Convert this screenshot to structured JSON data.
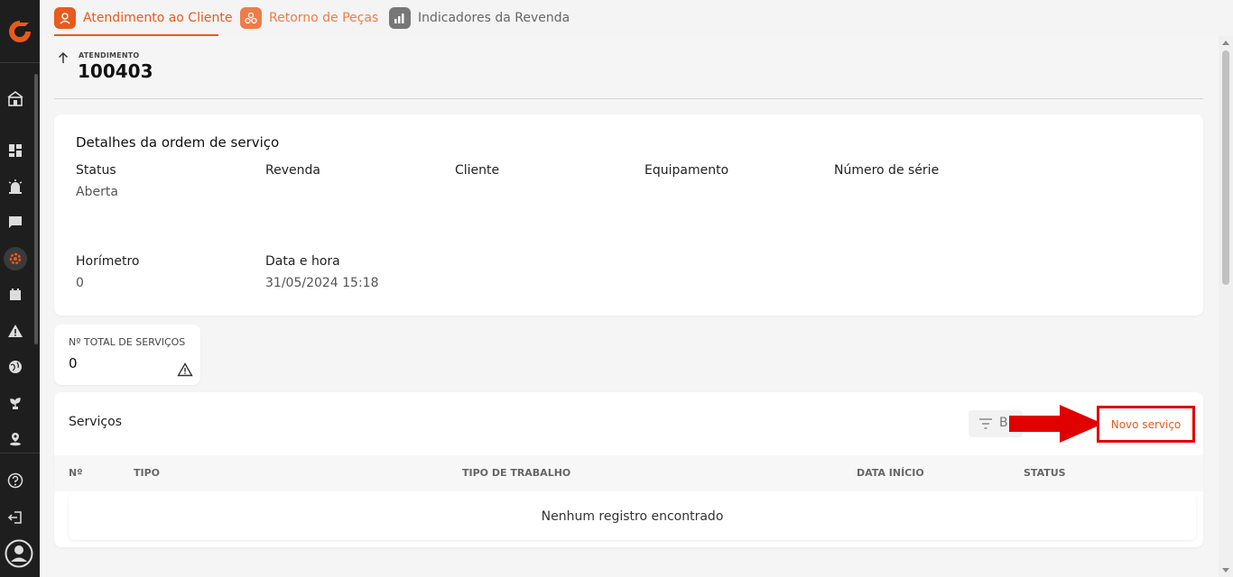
{
  "tabs": [
    {
      "label": "Atendimento ao Cliente",
      "color": "#e85a1d"
    },
    {
      "label": "Retorno de Peças",
      "color": "#ef7b48"
    },
    {
      "label": "Indicadores da Revenda",
      "color": "#777777"
    }
  ],
  "header": {
    "sup_label": "ATENDIMENTO",
    "number": "100403"
  },
  "details": {
    "title": "Detalhes da ordem de serviço",
    "fields": [
      {
        "label": "Status",
        "value": "Aberta"
      },
      {
        "label": "Revenda",
        "value": ""
      },
      {
        "label": "Cliente",
        "value": ""
      },
      {
        "label": "Equipamento",
        "value": ""
      },
      {
        "label": "Número de série",
        "value": ""
      },
      {
        "label": "Horímetro",
        "value": "0"
      },
      {
        "label": "Data e hora",
        "value": "31/05/2024 15:18"
      }
    ]
  },
  "total": {
    "label": "Nº TOTAL DE SERVIÇOS",
    "value": "0"
  },
  "services": {
    "title": "Serviços",
    "filter_label": "B",
    "new_button": "Novo serviço",
    "columns": [
      "Nº",
      "TIPO",
      "TIPO DE TRABALHO",
      "DATA INÍCIO",
      "STATUS"
    ],
    "empty_text": "Nenhum registro encontrado"
  },
  "colors": {
    "accent": "#e85a1d",
    "highlight": "#e00000"
  }
}
